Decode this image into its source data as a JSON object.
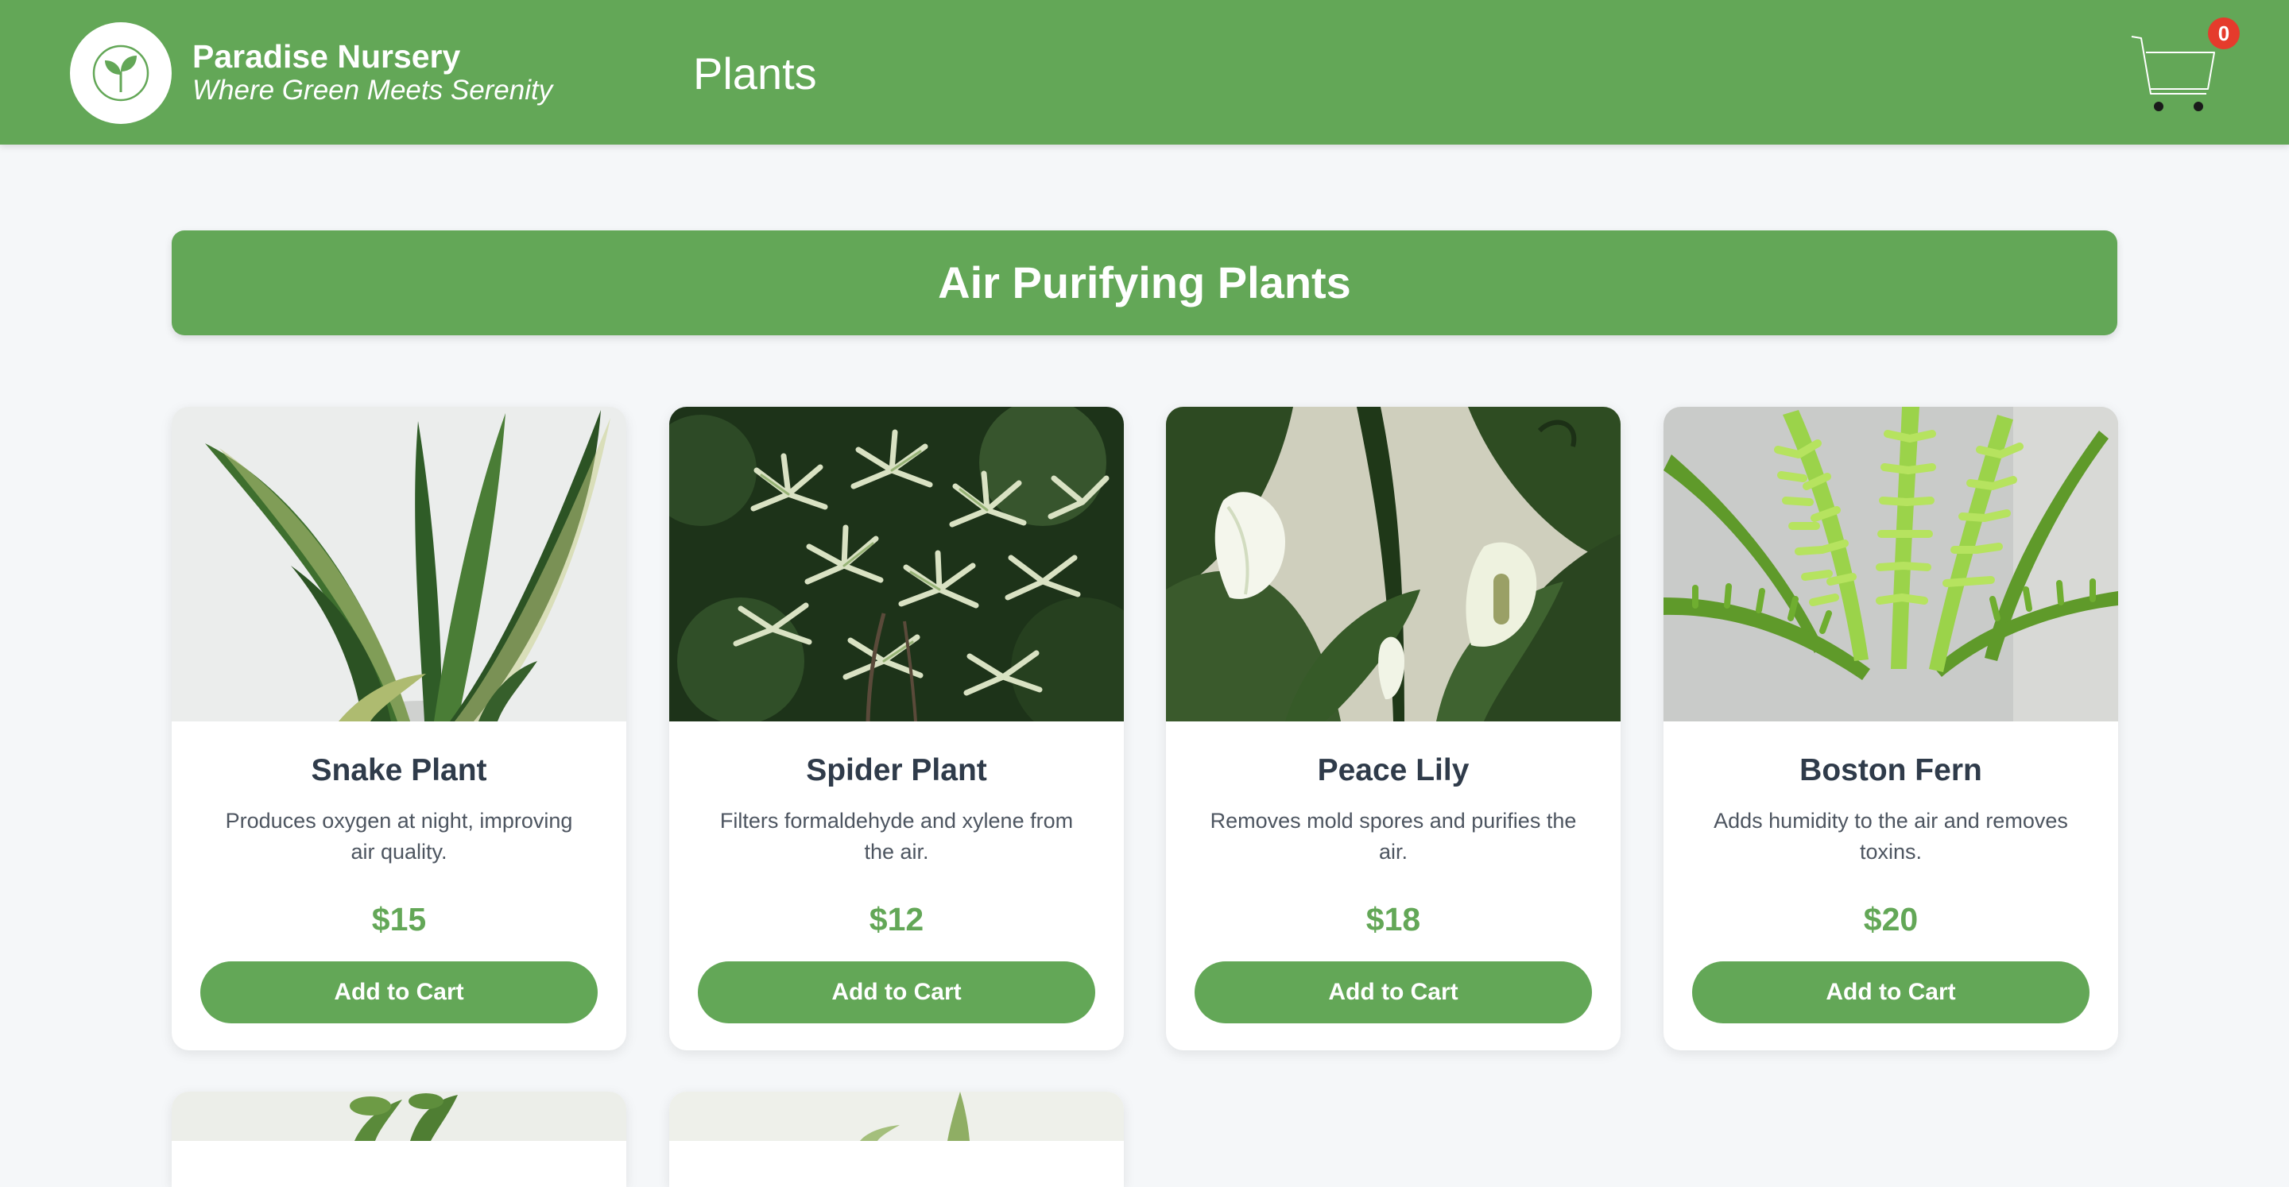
{
  "colors": {
    "primary_green": "#63a757",
    "page_background": "#f5f7f9",
    "card_title_text": "#2f3b4a",
    "badge_red": "#e53b2c"
  },
  "header": {
    "brand_name": "Paradise Nursery",
    "tagline": "Where Green Meets Serenity",
    "logo_icon": "sprout-icon",
    "nav_link": "Plants",
    "cart_icon": "shopping-cart-icon",
    "cart_count": "0"
  },
  "section": {
    "title": "Air Purifying Plants"
  },
  "plants": [
    {
      "name": "Snake Plant",
      "description": "Produces oxygen at night, improving air quality.",
      "price": "$15",
      "button": "Add to Cart"
    },
    {
      "name": "Spider Plant",
      "description": "Filters formaldehyde and xylene from the air.",
      "price": "$12",
      "button": "Add to Cart"
    },
    {
      "name": "Peace Lily",
      "description": "Removes mold spores and purifies the air.",
      "price": "$18",
      "button": "Add to Cart"
    },
    {
      "name": "Boston Fern",
      "description": "Adds humidity to the air and removes toxins.",
      "price": "$20",
      "button": "Add to Cart"
    }
  ]
}
